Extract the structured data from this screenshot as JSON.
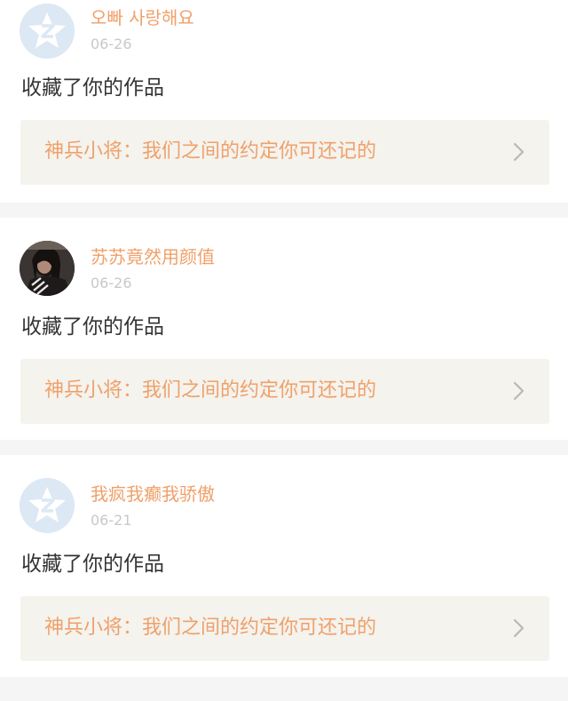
{
  "notifications": [
    {
      "username": "오빠 사랑해요",
      "date": "06-26",
      "avatar": "default-avatar-icon",
      "action": "收藏了你的作品",
      "work": "神兵小将：我们之间的约定你可还记的"
    },
    {
      "username": "苏苏竟然用颜值",
      "date": "06-26",
      "avatar": "user-photo",
      "action": "收藏了你的作品",
      "work": "神兵小将：我们之间的约定你可还记的"
    },
    {
      "username": "我疯我癫我骄傲",
      "date": "06-21",
      "avatar": "default-avatar-icon",
      "action": "收藏了你的作品",
      "work": "神兵小将：我们之间的约定你可还记的"
    }
  ],
  "colors": {
    "accent": "#f0a06a",
    "date": "#c8c8c8",
    "text": "#333333",
    "link_bg": "#f4f3ee",
    "separator": "#f5f5f5",
    "avatar_bg": "#dce8f4"
  }
}
